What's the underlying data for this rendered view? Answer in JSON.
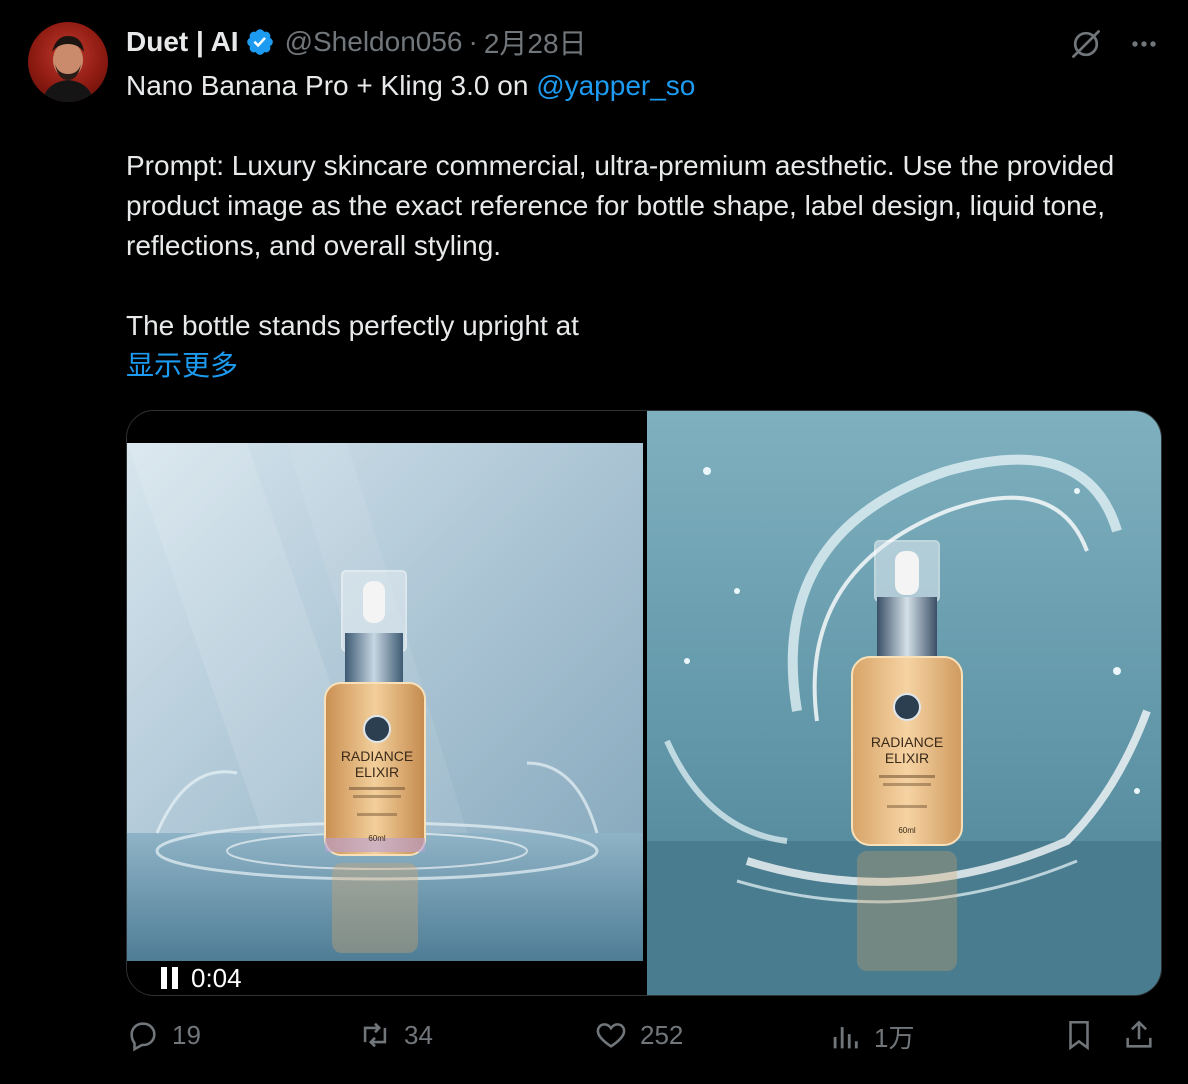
{
  "author": {
    "display_name": "Duet | AI",
    "handle": "@Sheldon056",
    "separator": "·",
    "timestamp": "2月28日",
    "verified_color": "#1d9bf0"
  },
  "tweet": {
    "line1_prefix": "Nano Banana Pro + Kling 3.0 on ",
    "line1_mention": "@yapper_so",
    "paragraph2": "Prompt: Luxury skincare commercial, ultra-premium aesthetic. Use the provided product image as the exact reference for bottle shape, label design, liquid tone, reflections, and overall styling.",
    "paragraph3": "The bottle stands perfectly upright at",
    "show_more": "显示更多"
  },
  "media": {
    "video_time": "0:04",
    "product_name_line1": "RADIANCE",
    "product_name_line2": "ELIXIR",
    "product_volume": "60ml"
  },
  "actions": {
    "replies": "19",
    "reposts": "34",
    "likes": "252",
    "views": "1万"
  },
  "colors": {
    "background": "#000000",
    "text": "#e7e9ea",
    "muted": "#71767b",
    "accent": "#1d9bf0"
  }
}
